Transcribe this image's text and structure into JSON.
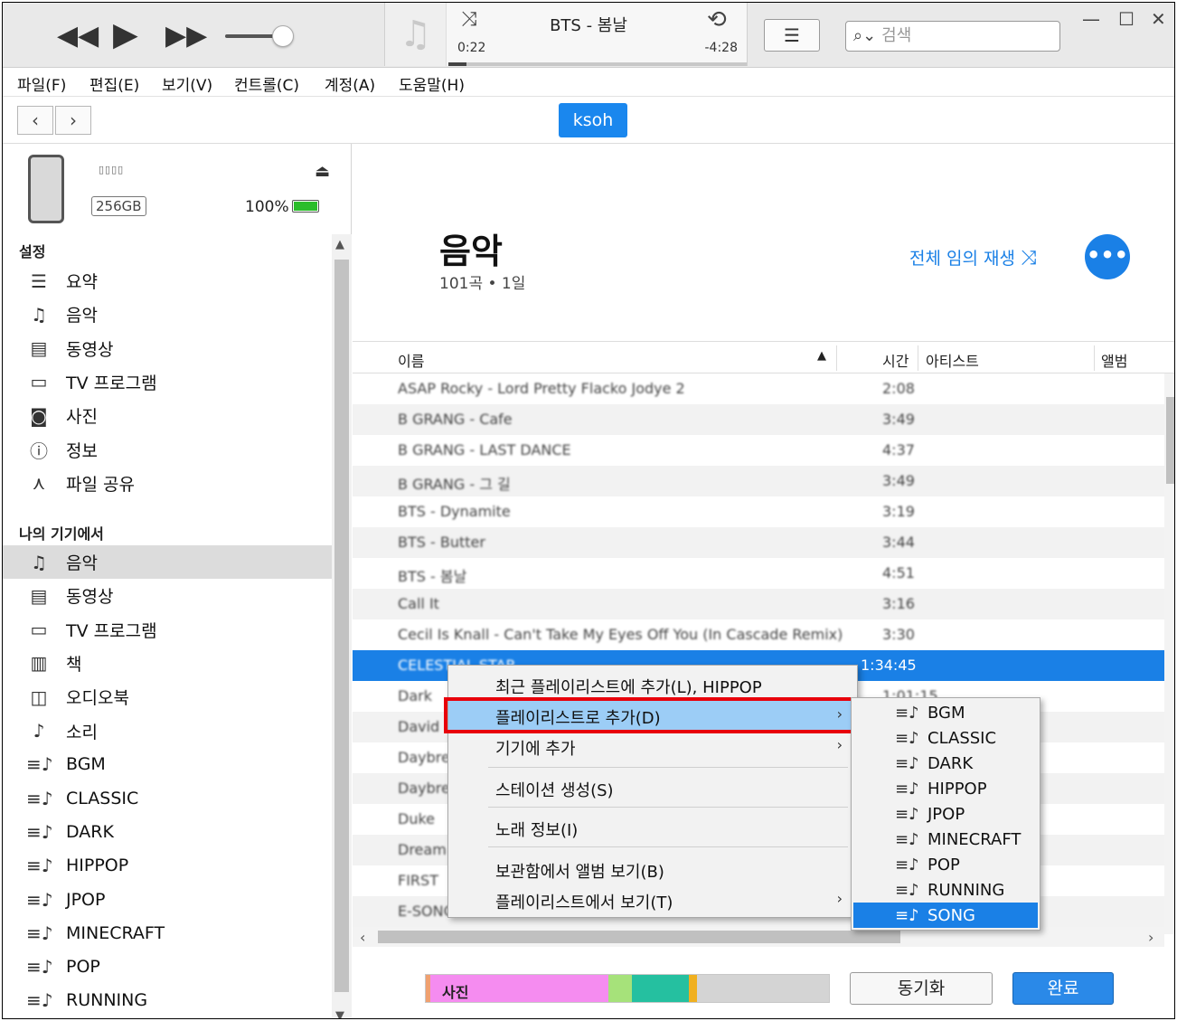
{
  "player": {
    "now_playing": "BTS - 봄날",
    "elapsed": "0:22",
    "remaining": "-4:28",
    "progress_fraction": 0.06,
    "volume_fraction": 0.72,
    "search_placeholder": "검색"
  },
  "menu": [
    "파일(F)",
    "편집(E)",
    "보기(V)",
    "컨트롤(C)",
    "계정(A)",
    "도움말(H)"
  ],
  "device": {
    "pill": "ksoh",
    "capacity": "256GB",
    "battery": "100%"
  },
  "sidebar": {
    "settings_heading": "설정",
    "settings": [
      {
        "label": "요약",
        "icon": "summary-icon"
      },
      {
        "label": "음악",
        "icon": "music-note-icon"
      },
      {
        "label": "동영상",
        "icon": "film-icon"
      },
      {
        "label": "TV 프로그램",
        "icon": "tv-icon"
      },
      {
        "label": "사진",
        "icon": "camera-icon"
      },
      {
        "label": "정보",
        "icon": "info-icon"
      },
      {
        "label": "파일 공유",
        "icon": "file-sharing-icon"
      }
    ],
    "device_heading": "나의 기기에서",
    "device_items": [
      {
        "label": "음악",
        "icon": "music-note-icon"
      },
      {
        "label": "동영상",
        "icon": "film-icon"
      },
      {
        "label": "TV 프로그램",
        "icon": "tv-icon"
      },
      {
        "label": "책",
        "icon": "book-icon"
      },
      {
        "label": "오디오북",
        "icon": "audiobook-icon"
      },
      {
        "label": "소리",
        "icon": "bell-icon"
      },
      {
        "label": "BGM",
        "icon": "playlist-icon"
      },
      {
        "label": "CLASSIC",
        "icon": "playlist-icon"
      },
      {
        "label": "DARK",
        "icon": "playlist-icon"
      },
      {
        "label": "HIPPOP",
        "icon": "playlist-icon"
      },
      {
        "label": "JPOP",
        "icon": "playlist-icon"
      },
      {
        "label": "MINECRAFT",
        "icon": "playlist-icon"
      },
      {
        "label": "POP",
        "icon": "playlist-icon"
      },
      {
        "label": "RUNNING",
        "icon": "playlist-icon"
      }
    ]
  },
  "main": {
    "title": "음악",
    "subtitle": "101곡 • 1일",
    "shuffle_all": "전체 임의 재생",
    "columns": {
      "name": "이름",
      "time": "시간",
      "artist": "아티스트",
      "album": "앨범"
    },
    "rows": [
      {
        "name": "ASAP Rocky - Lord Pretty Flacko Jodye 2",
        "time": "2:08"
      },
      {
        "name": "B GRANG - Cafe",
        "time": "3:49"
      },
      {
        "name": "B GRANG - LAST DANCE",
        "time": "4:37"
      },
      {
        "name": "B GRANG - 그 길",
        "time": "3:49"
      },
      {
        "name": "BTS - Dynamite",
        "time": "3:19"
      },
      {
        "name": "BTS - Butter",
        "time": "3:44"
      },
      {
        "name": "BTS - 봄날",
        "time": "4:51"
      },
      {
        "name": "Call It",
        "time": "3:16"
      },
      {
        "name": "Cecil Is Knall - Can't Take My Eyes Off You (In Cascade Remix)",
        "time": "3:30"
      },
      {
        "name": "CELESTIAL STAR",
        "time": "1:34:45"
      },
      {
        "name": "Dark",
        "time": "1:01:15"
      },
      {
        "name": "David",
        "time": ""
      },
      {
        "name": "Daybreak",
        "time": ""
      },
      {
        "name": "Daybreak",
        "time": ""
      },
      {
        "name": "Duke",
        "time": ""
      },
      {
        "name": "Dream",
        "time": ""
      },
      {
        "name": "FIRST",
        "time": ""
      },
      {
        "name": "E-SONG",
        "time": ""
      }
    ]
  },
  "context_menu": {
    "items": [
      {
        "label": "최근 플레이리스트에 추가(L), HIPPOP",
        "submenu": false
      },
      {
        "label": "플레이리스트로 추가(D)",
        "submenu": true
      },
      {
        "label": "기기에 추가",
        "submenu": true
      },
      {
        "label": "스테이션 생성(S)",
        "submenu": false
      },
      {
        "label": "노래 정보(I)",
        "submenu": false
      },
      {
        "label": "보관함에서 앨범 보기(B)",
        "submenu": false
      },
      {
        "label": "플레이리스트에서 보기(T)",
        "submenu": true
      }
    ],
    "submenu_playlists": [
      "BGM",
      "CLASSIC",
      "DARK",
      "HIPPOP",
      "JPOP",
      "MINECRAFT",
      "POP",
      "RUNNING",
      "SONG"
    ],
    "submenu_selected": "SONG"
  },
  "footer": {
    "storage_label": "사진",
    "segments": [
      {
        "color": "#f0a070",
        "fraction": 0.012
      },
      {
        "color": "#f58cf0",
        "fraction": 0.44
      },
      {
        "color": "#a6e27a",
        "fraction": 0.06
      },
      {
        "color": "#25c0a0",
        "fraction": 0.14
      },
      {
        "color": "#f0b020",
        "fraction": 0.02
      }
    ],
    "sync": "동기화",
    "done": "완료"
  },
  "colors": {
    "accent": "#1a80e6",
    "highlight": "#9ccdf6",
    "callout": "#e8000b"
  }
}
